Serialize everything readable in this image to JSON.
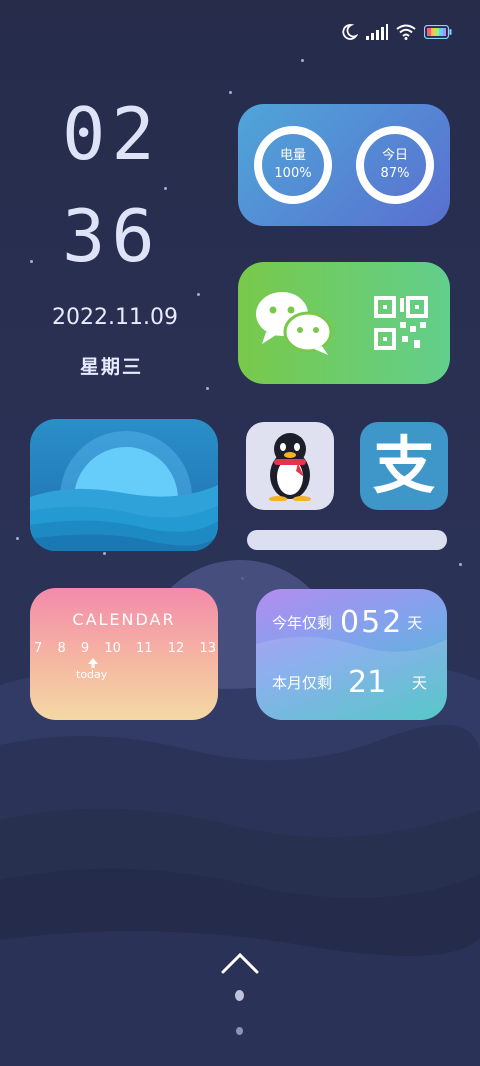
{
  "status": {
    "icons": [
      "moon-icon",
      "signal-icon",
      "wifi-icon",
      "battery-icon"
    ]
  },
  "clock": {
    "hours": "02",
    "minutes": "36"
  },
  "date": "2022.11.09",
  "weekday": "星期三",
  "rings": [
    {
      "label": "电量",
      "value": "100%"
    },
    {
      "label": "今日",
      "value": "87%"
    }
  ],
  "calendar": {
    "title": "CALENDAR",
    "days": [
      "7",
      "8",
      "9",
      "10",
      "11",
      "12",
      "13"
    ],
    "today_label": "today"
  },
  "countdown": {
    "year_label": "今年仅剩",
    "year_value": "052",
    "month_label": "本月仅剩",
    "month_value": "21",
    "unit": "天"
  },
  "apps": {
    "wechat": "wechat-icon",
    "qr": "qr-code-icon",
    "qq": "qq-penguin-icon",
    "alipay": "alipay-icon",
    "alipay_glyph": "支"
  },
  "colors": {
    "ring_card_start": "#4fa6d8",
    "ring_card_end": "#5a6fd0",
    "wechat_card_start": "#74c84a",
    "wechat_card_end": "#62cf8c",
    "alipay": "#3f97c9"
  }
}
